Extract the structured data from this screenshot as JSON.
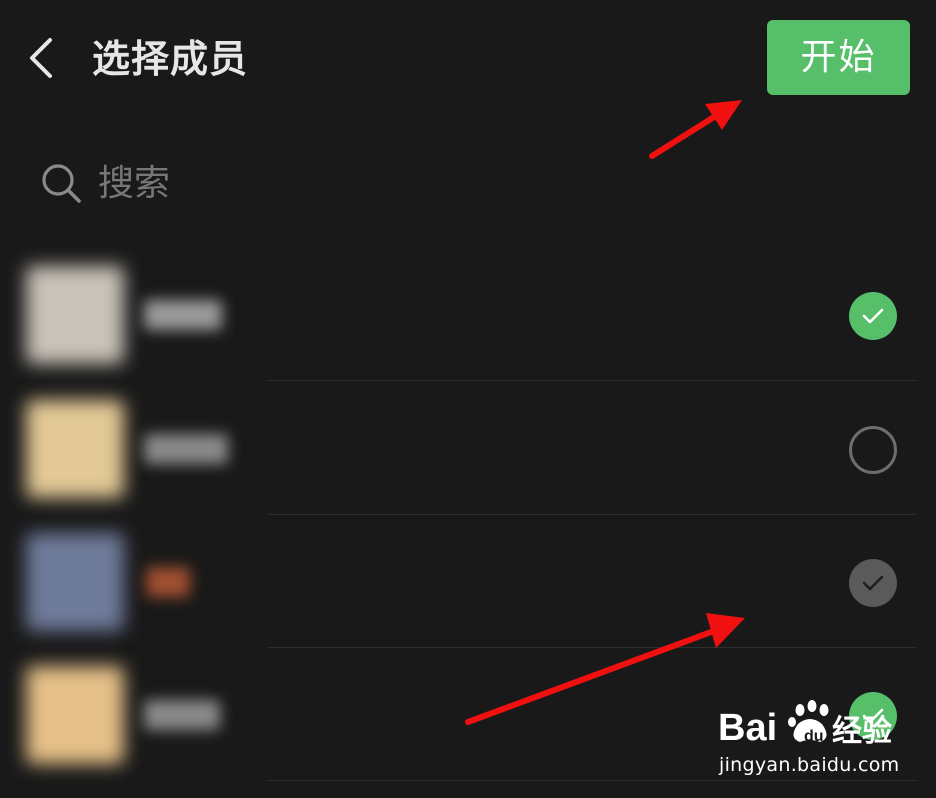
{
  "header": {
    "title": "选择成员",
    "start_label": "开始"
  },
  "search": {
    "placeholder": "搜索"
  },
  "members": [
    {
      "state": "selected",
      "avatar_color": "#c9c2b8",
      "name_color": "#9a9a9a"
    },
    {
      "state": "unselected",
      "avatar_color": "#e3c996",
      "name_color": "#8a8a8a"
    },
    {
      "state": "preselected",
      "avatar_color": "#6f7b9a",
      "name_color": "#a05030"
    },
    {
      "state": "selected",
      "avatar_color": "#e5c088",
      "name_color": "#8a8a8a"
    }
  ],
  "colors": {
    "background": "#191919",
    "accent_green": "#57be6a",
    "annotation_red": "#f01010"
  },
  "icons": {
    "back": "chevron-left-icon",
    "search": "search-icon",
    "check": "checkmark-icon"
  },
  "watermark": {
    "brand": "Bai du 经验",
    "url": "jingyan.baidu.com"
  }
}
